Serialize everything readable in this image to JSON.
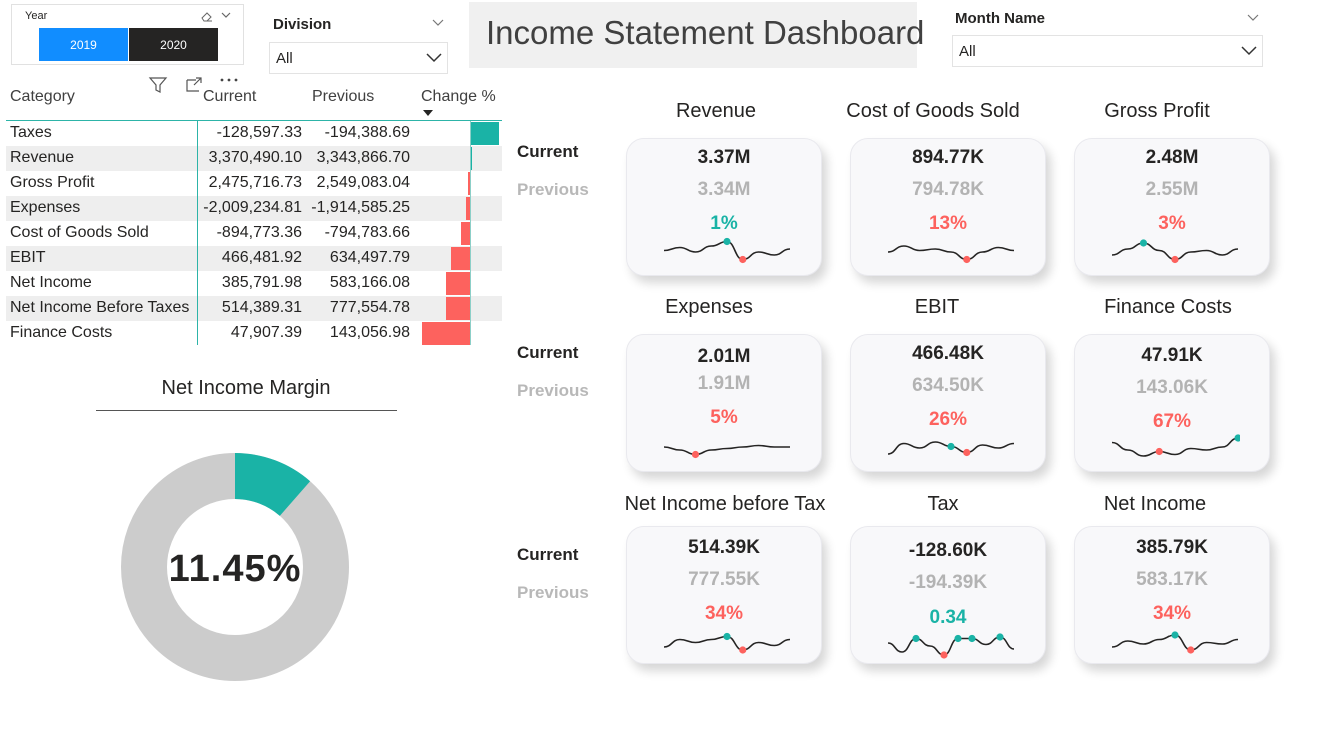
{
  "colors": {
    "accent_blue": "#118dff",
    "selected_dark": "#252423",
    "positive": "#1ab3a6",
    "negative": "#fd625e",
    "spark_line": "#252423",
    "previous_gray": "#b3b3b3"
  },
  "year_slicer": {
    "title": "Year",
    "options": [
      "2019",
      "2020"
    ],
    "icons": [
      "eraser-icon",
      "chevron-down-icon"
    ]
  },
  "division_slicer": {
    "title": "Division",
    "value": "All"
  },
  "month_slicer": {
    "title": "Month Name",
    "value": "All"
  },
  "dashboard_title": "Income Statement Dashboard",
  "visual_header": {
    "icons": [
      "filter-icon",
      "focus-mode-icon",
      "more-options-icon"
    ]
  },
  "table": {
    "headers": {
      "category": "Category",
      "current": "Current",
      "previous": "Previous",
      "change": "Change %"
    },
    "rows": [
      {
        "category": "Taxes",
        "current": "-128,597.33",
        "previous": "-194,388.69",
        "change_pct": 33.8
      },
      {
        "category": "Revenue",
        "current": "3,370,490.10",
        "previous": "3,343,866.70",
        "change_pct": 0.8
      },
      {
        "category": "Gross Profit",
        "current": "2,475,716.73",
        "previous": "2,549,083.04",
        "change_pct": -2.9
      },
      {
        "category": "Expenses",
        "current": "-2,009,234.81",
        "previous": "-1,914,585.25",
        "change_pct": -4.9
      },
      {
        "category": "Cost of Goods Sold",
        "current": "-894,773.36",
        "previous": "-794,783.66",
        "change_pct": -12.6
      },
      {
        "category": "EBIT",
        "current": "466,481.92",
        "previous": "634,497.79",
        "change_pct": -26.5
      },
      {
        "category": "Net Income",
        "current": "385,791.98",
        "previous": "583,166.08",
        "change_pct": -33.8
      },
      {
        "category": "Net Income Before Taxes",
        "current": "514,389.31",
        "previous": "777,554.78",
        "change_pct": -33.8
      },
      {
        "category": "Finance Costs",
        "current": "47,907.39",
        "previous": "143,056.98",
        "change_pct": -66.5
      }
    ]
  },
  "net_income_margin": {
    "title": "Net Income Margin",
    "value": "11.45%",
    "fraction": 0.1145
  },
  "row_labels": {
    "current": "Current",
    "previous": "Previous"
  },
  "kpis": [
    {
      "title": "Revenue",
      "current": "3.37M",
      "previous": "3.34M",
      "change": "1%",
      "trend": "positive",
      "spark": [
        0.55,
        0.45,
        0.6,
        0.4,
        0.25,
        0.85,
        0.6,
        0.7,
        0.5
      ],
      "markers": [
        {
          "i": 4,
          "c": "positive"
        },
        {
          "i": 5,
          "c": "negative"
        }
      ]
    },
    {
      "title": "Cost of Goods Sold",
      "current": "894.77K",
      "previous": "794.78K",
      "change": "13%",
      "trend": "negative",
      "spark": [
        0.6,
        0.4,
        0.55,
        0.5,
        0.6,
        0.85,
        0.6,
        0.45,
        0.55
      ],
      "markers": [
        {
          "i": 5,
          "c": "negative"
        }
      ]
    },
    {
      "title": "Gross Profit",
      "current": "2.48M",
      "previous": "2.55M",
      "change": "3%",
      "trend": "negative",
      "spark": [
        0.7,
        0.5,
        0.3,
        0.55,
        0.85,
        0.6,
        0.55,
        0.7,
        0.5
      ],
      "markers": [
        {
          "i": 2,
          "c": "positive"
        },
        {
          "i": 4,
          "c": "negative"
        }
      ]
    },
    {
      "title": "Expenses",
      "current": "2.01M",
      "previous": "1.91M",
      "change": "5%",
      "trend": "negative",
      "spark": [
        0.5,
        0.6,
        0.75,
        0.6,
        0.55,
        0.5,
        0.45,
        0.5,
        0.5
      ],
      "markers": [
        {
          "i": 2,
          "c": "negative"
        }
      ]
    },
    {
      "title": "EBIT",
      "current": "466.48K",
      "previous": "634.50K",
      "change": "26%",
      "trend": "negative",
      "spark": [
        0.8,
        0.45,
        0.6,
        0.4,
        0.55,
        0.75,
        0.5,
        0.6,
        0.45
      ],
      "markers": [
        {
          "i": 4,
          "c": "positive"
        },
        {
          "i": 5,
          "c": "negative"
        }
      ]
    },
    {
      "title": "Finance Costs",
      "current": "47.91K",
      "previous": "143.06K",
      "change": "67%",
      "trend": "negative",
      "spark": [
        0.35,
        0.6,
        0.8,
        0.65,
        0.75,
        0.55,
        0.6,
        0.5,
        0.2
      ],
      "markers": [
        {
          "i": 3,
          "c": "negative"
        },
        {
          "i": 8,
          "c": "positive"
        }
      ]
    },
    {
      "title": "Net Income before Tax",
      "current": "514.39K",
      "previous": "777.55K",
      "change": "34%",
      "trend": "negative",
      "spark": [
        0.7,
        0.45,
        0.55,
        0.45,
        0.35,
        0.8,
        0.55,
        0.65,
        0.45
      ],
      "markers": [
        {
          "i": 4,
          "c": "positive"
        },
        {
          "i": 5,
          "c": "negative"
        }
      ]
    },
    {
      "title": "Tax",
      "current": "-128.60K",
      "previous": "-194.39K",
      "change": "0.34",
      "trend": "positive",
      "spark": [
        0.5,
        0.8,
        0.35,
        0.6,
        0.9,
        0.35,
        0.35,
        0.55,
        0.3,
        0.7
      ],
      "markers": [
        {
          "i": 2,
          "c": "positive"
        },
        {
          "i": 4,
          "c": "negative"
        },
        {
          "i": 5,
          "c": "positive"
        },
        {
          "i": 6,
          "c": "positive"
        },
        {
          "i": 8,
          "c": "positive"
        }
      ]
    },
    {
      "title": "Net Income",
      "current": "385.79K",
      "previous": "583.17K",
      "change": "34%",
      "trend": "negative",
      "spark": [
        0.7,
        0.5,
        0.6,
        0.45,
        0.3,
        0.8,
        0.55,
        0.6,
        0.45
      ],
      "markers": [
        {
          "i": 4,
          "c": "positive"
        },
        {
          "i": 5,
          "c": "negative"
        }
      ]
    }
  ]
}
